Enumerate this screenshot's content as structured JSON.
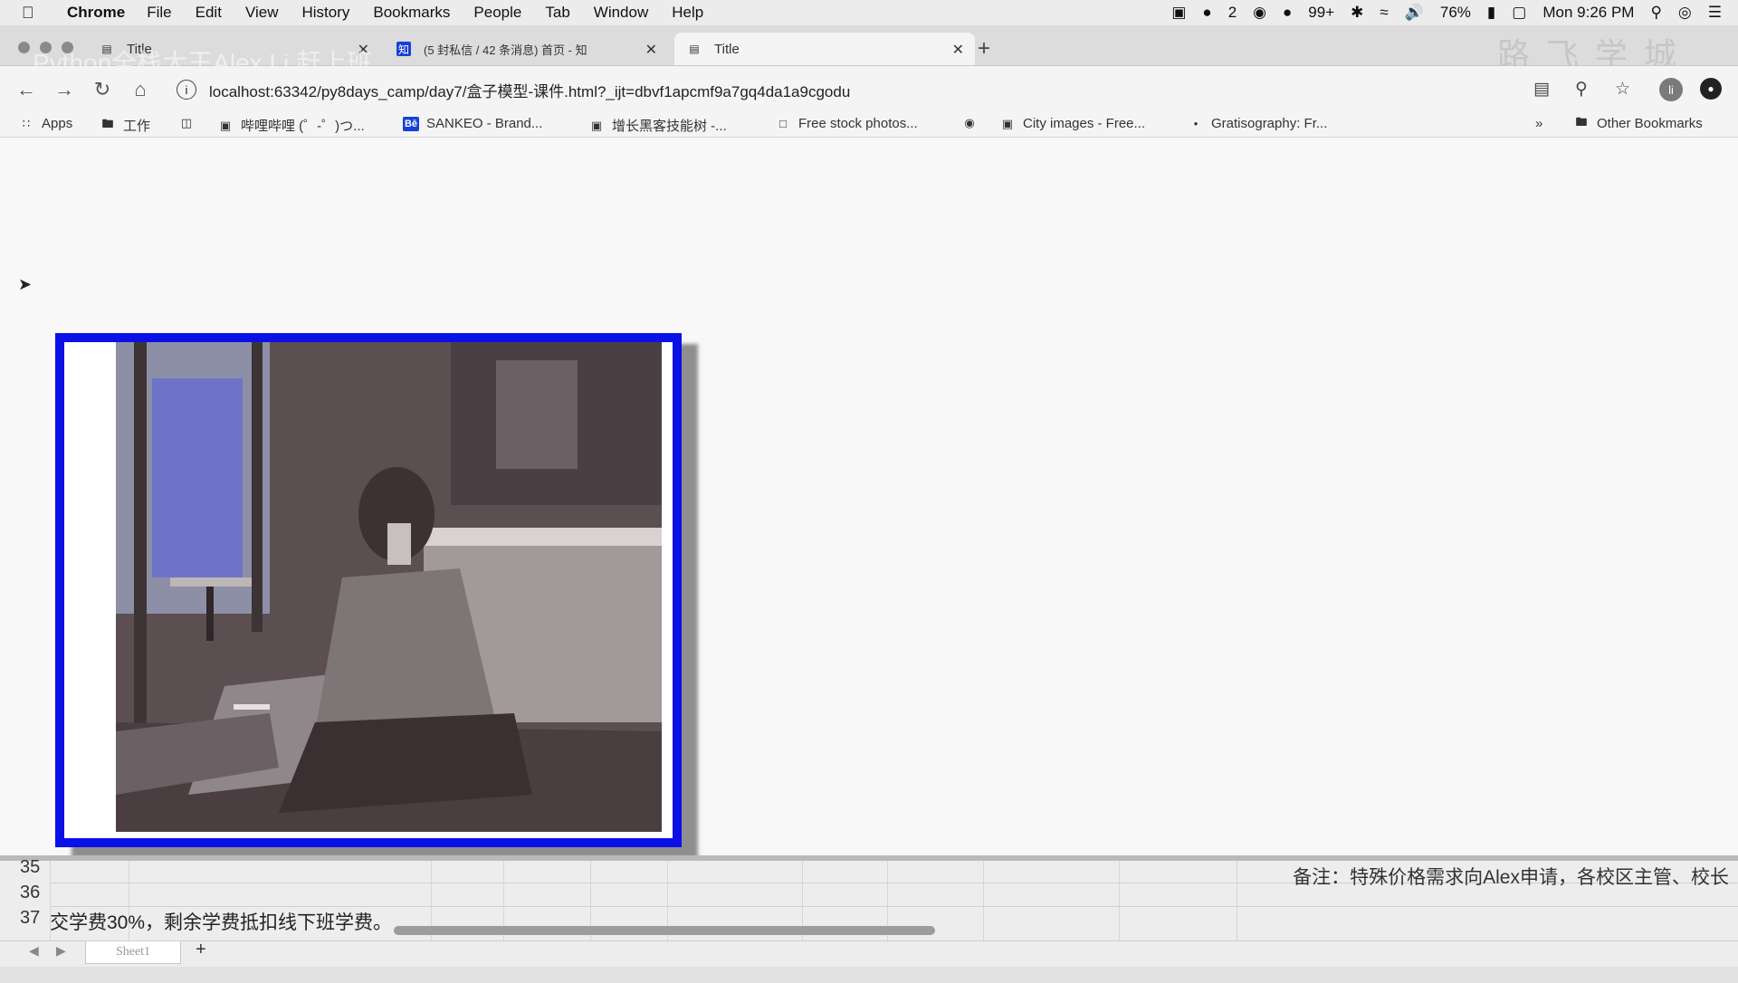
{
  "menubar": {
    "app_name": "Chrome",
    "items": [
      "File",
      "Edit",
      "View",
      "History",
      "Bookmarks",
      "People",
      "Tab",
      "Window",
      "Help"
    ],
    "status": {
      "notif_count": "2",
      "qq_count": "99+",
      "battery": "76%",
      "clock": "Mon 9:26 PM"
    }
  },
  "tabs": [
    {
      "title": "Title",
      "active": false
    },
    {
      "title": "(5 封私信 / 42 条消息) 首页 - 知",
      "active": false
    },
    {
      "title": "Title",
      "active": true
    }
  ],
  "watermark": "路飞学城",
  "ghost_overlay": "Python全栈大王Alex Li 赶上班",
  "address_bar": {
    "url": "localhost:63342/py8days_camp/day7/盒子模型-课件.html?_ijt=dbvf1apcmf9a7gq4da1a9cgodu"
  },
  "profile_initial": "li",
  "bookmarks": [
    {
      "label": "Apps",
      "icon": "apps-grid-icon"
    },
    {
      "label": "工作",
      "icon": "folder-icon"
    },
    {
      "label": "",
      "icon": "bilibili-icon"
    },
    {
      "label": "哔哩哔哩 (゜-゜)つ...",
      "icon": "tv-icon"
    },
    {
      "label": "SANKEO - Brand...",
      "icon": "behance-icon"
    },
    {
      "label": "增长黑客技能树 -...",
      "icon": "cube-icon"
    },
    {
      "label": "Free stock photos...",
      "icon": "pexels-icon"
    },
    {
      "label": "",
      "icon": "globe-icon"
    },
    {
      "label": "City images - Free...",
      "icon": "camera-icon"
    },
    {
      "label": "Gratisography: Fr...",
      "icon": "dot-icon"
    }
  ],
  "bookmarks_overflow": "»",
  "other_bookmarks": "Other Bookmarks",
  "page": {
    "box_border_color": "#0a10e6",
    "image_alt": "photo"
  },
  "spreadsheet": {
    "rows": [
      "35",
      "36",
      "37"
    ],
    "note": "备注：特殊价格需求向Alex申请，各校区主管、校长",
    "row37_text": "交学费30%，剩余学费抵扣线下班学费。",
    "sheet_tab": "Sheet1",
    "add_sheet": "+"
  }
}
